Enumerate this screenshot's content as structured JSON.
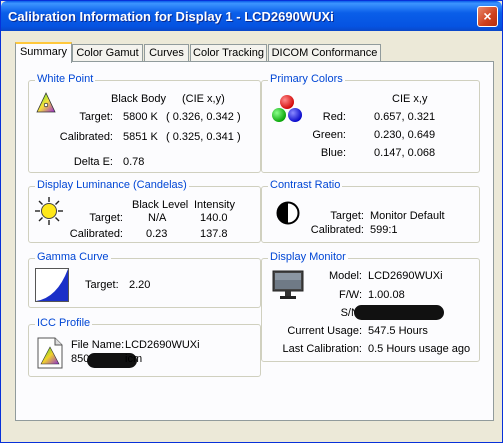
{
  "window": {
    "title": "Calibration Information for Display 1 - LCD2690WUXi",
    "close_glyph": "×"
  },
  "tabs": [
    {
      "label": "Summary"
    },
    {
      "label": "Color Gamut"
    },
    {
      "label": "Curves"
    },
    {
      "label": "Color Tracking"
    },
    {
      "label": "DICOM Conformance"
    }
  ],
  "white_point": {
    "title": "White Point",
    "col_black_body": "Black Body",
    "col_cie": "(CIE x,y)",
    "target_label": "Target:",
    "target_kelvin": "5800 K",
    "target_xy": "( 0.326, 0.342 )",
    "calibrated_label": "Calibrated:",
    "calibrated_kelvin": "5851 K",
    "calibrated_xy": "( 0.325, 0.341 )",
    "delta_label": "Delta E:",
    "delta_value": "0.78"
  },
  "primary_colors": {
    "title": "Primary Colors",
    "col_cie": "CIE x,y",
    "red_label": "Red:",
    "red_value": "0.657, 0.321",
    "green_label": "Green:",
    "green_value": "0.230, 0.649",
    "blue_label": "Blue:",
    "blue_value": "0.147, 0.068"
  },
  "luminance": {
    "title": "Display Luminance (Candelas)",
    "col_black": "Black Level",
    "col_intensity": "Intensity",
    "target_label": "Target:",
    "target_black": "N/A",
    "target_intensity": "140.0",
    "calibrated_label": "Calibrated:",
    "calibrated_black": "0.23",
    "calibrated_intensity": "137.8"
  },
  "contrast": {
    "title": "Contrast Ratio",
    "target_label": "Target:",
    "target_value": "Monitor Default",
    "calibrated_label": "Calibrated:",
    "calibrated_value": "599:1"
  },
  "gamma": {
    "title": "Gamma Curve",
    "target_label": "Target:",
    "target_value": "2.20"
  },
  "monitor": {
    "title": "Display Monitor",
    "model_label": "Model:",
    "model_value": "LCD2690WUXi",
    "fw_label": "F/W:",
    "fw_value": "1.00.08",
    "sn_label": "S/N:",
    "sn_value": "",
    "usage_label": "Current Usage:",
    "usage_value": "547.5 Hours",
    "lastcal_label": "Last Calibration:",
    "lastcal_value": "0.5 Hours usage ago"
  },
  "icc": {
    "title": "ICC Profile",
    "file_label": "File Name:",
    "file_value": "LCD2690WUXi",
    "file_prefix": "850",
    "file_suffix": "icm"
  },
  "colors": {
    "accent_title": "#0046d5",
    "titlebar": "#0a5ee9",
    "tab_highlight": "#ffc83c"
  }
}
